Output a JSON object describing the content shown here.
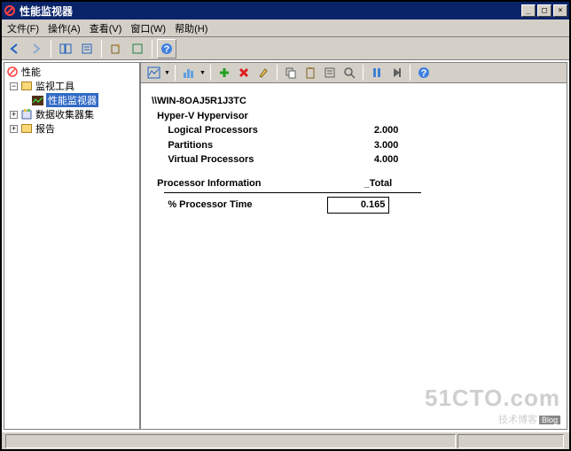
{
  "window": {
    "title": "性能监视器"
  },
  "menu": {
    "file": "文件(F)",
    "action": "操作(A)",
    "view": "查看(V)",
    "window": "窗口(W)",
    "help": "帮助(H)"
  },
  "tree": {
    "root": "性能",
    "node1": "监视工具",
    "node1a": "性能监视器",
    "node2": "数据收集器集",
    "node3": "报告"
  },
  "report": {
    "host": "\\\\WIN-8OAJ5R1J3TC",
    "group1": "Hyper-V Hypervisor",
    "m1": "Logical Processors",
    "v1": "2.000",
    "m2": "Partitions",
    "v2": "3.000",
    "m3": "Virtual Processors",
    "v3": "4.000",
    "group2": "Processor Information",
    "col": "_Total",
    "m4": "% Processor Time",
    "v4": "0.165"
  },
  "watermark": {
    "line1": "51CTO.com",
    "line2": "技术博客",
    "badge": "Blog"
  }
}
